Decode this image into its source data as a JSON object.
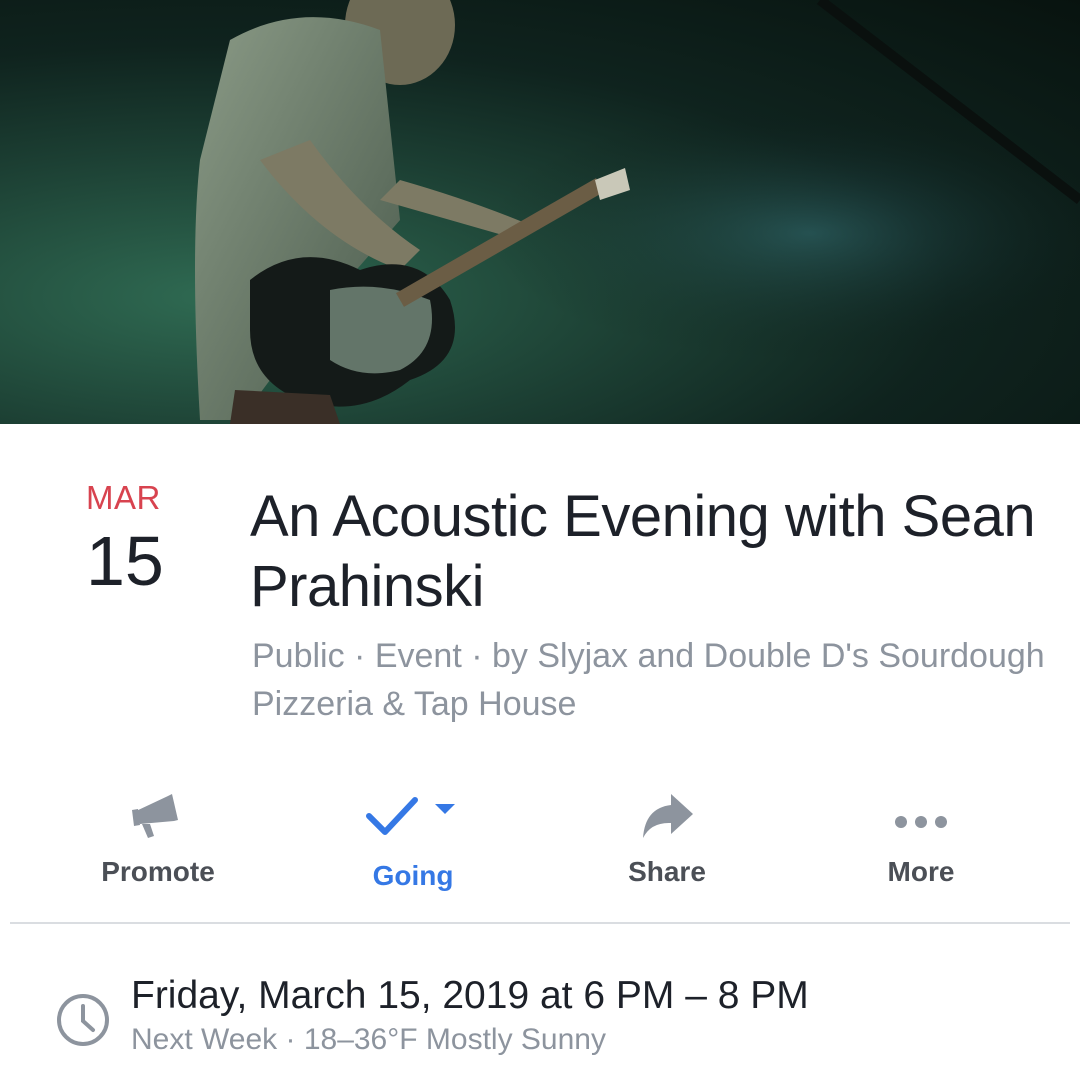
{
  "cover": {
    "photo": "guitarist-on-stage",
    "tint": "#1f4a3b"
  },
  "date_badge": {
    "month": "MAR",
    "day": "15",
    "month_color": "#d8434f"
  },
  "event": {
    "title": "An Acoustic Evening with Sean Prahinski",
    "meta": "Public · Event · by Slyjax and Double D's Sourdough Pizzeria & Tap House"
  },
  "actions": [
    {
      "label": "Promote",
      "icon": "megaphone-icon"
    },
    {
      "label": "Going",
      "icon": "checkmark-icon",
      "accent": "#3578e5"
    },
    {
      "label": "Share",
      "icon": "share-arrow-icon"
    },
    {
      "label": "More",
      "icon": "ellipsis-icon"
    }
  ],
  "when": {
    "title": "Friday, March 15, 2019 at 6 PM – 8 PM",
    "subtitle": "Next Week · 18–36°F Mostly Sunny",
    "icon": "clock-icon"
  }
}
